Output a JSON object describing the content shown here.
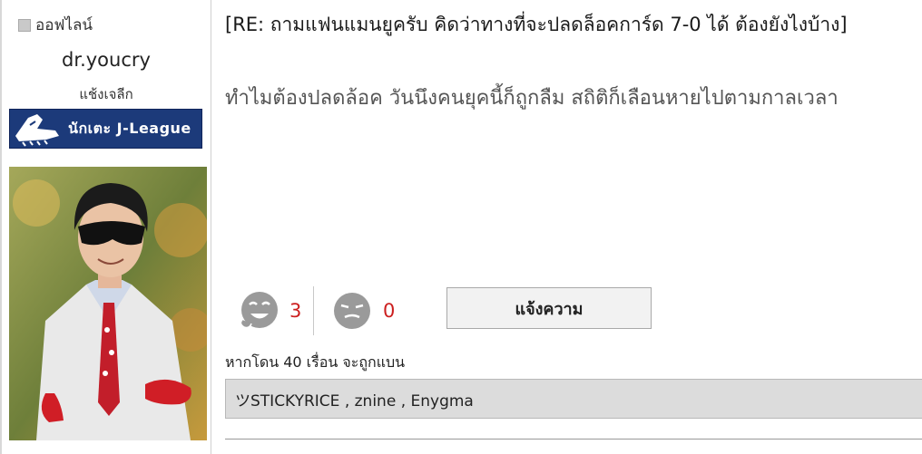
{
  "sidebar": {
    "status_label": "ออฟไลน์",
    "username": "dr.youcry",
    "rank": "แช้งเจลีก",
    "badge_label": "นักเตะ J-League",
    "badge_icon": "football-boot-icon"
  },
  "post": {
    "title": "[RE: ถามแฟนแมนยูครับ คิดว่าทางที่จะปลดล็อคการ์ด 7-0 ได้ ต้องยังไงบ้าง]",
    "body": "ทำไมต้องปลดล้อค วันนึงคนยุคนี้ก็ถูกลืม สถิติก็เลือนหายไปตามกาลเวลา"
  },
  "reactions": {
    "like_icon": "laughing-face-icon",
    "like_count": "3",
    "dislike_icon": "sleepy-face-icon",
    "dislike_count": "0"
  },
  "report": {
    "button_label": "แจ้งความ",
    "ban_note": "หากโดน 40 เรื่อน จะถูกแบน",
    "reporters": "ツSTICKYRICE , znine , Enygma"
  },
  "colors": {
    "count_red": "#cc1f1f",
    "badge_blue": "#1c3a7a",
    "reporters_bg": "#dcdcdc"
  }
}
